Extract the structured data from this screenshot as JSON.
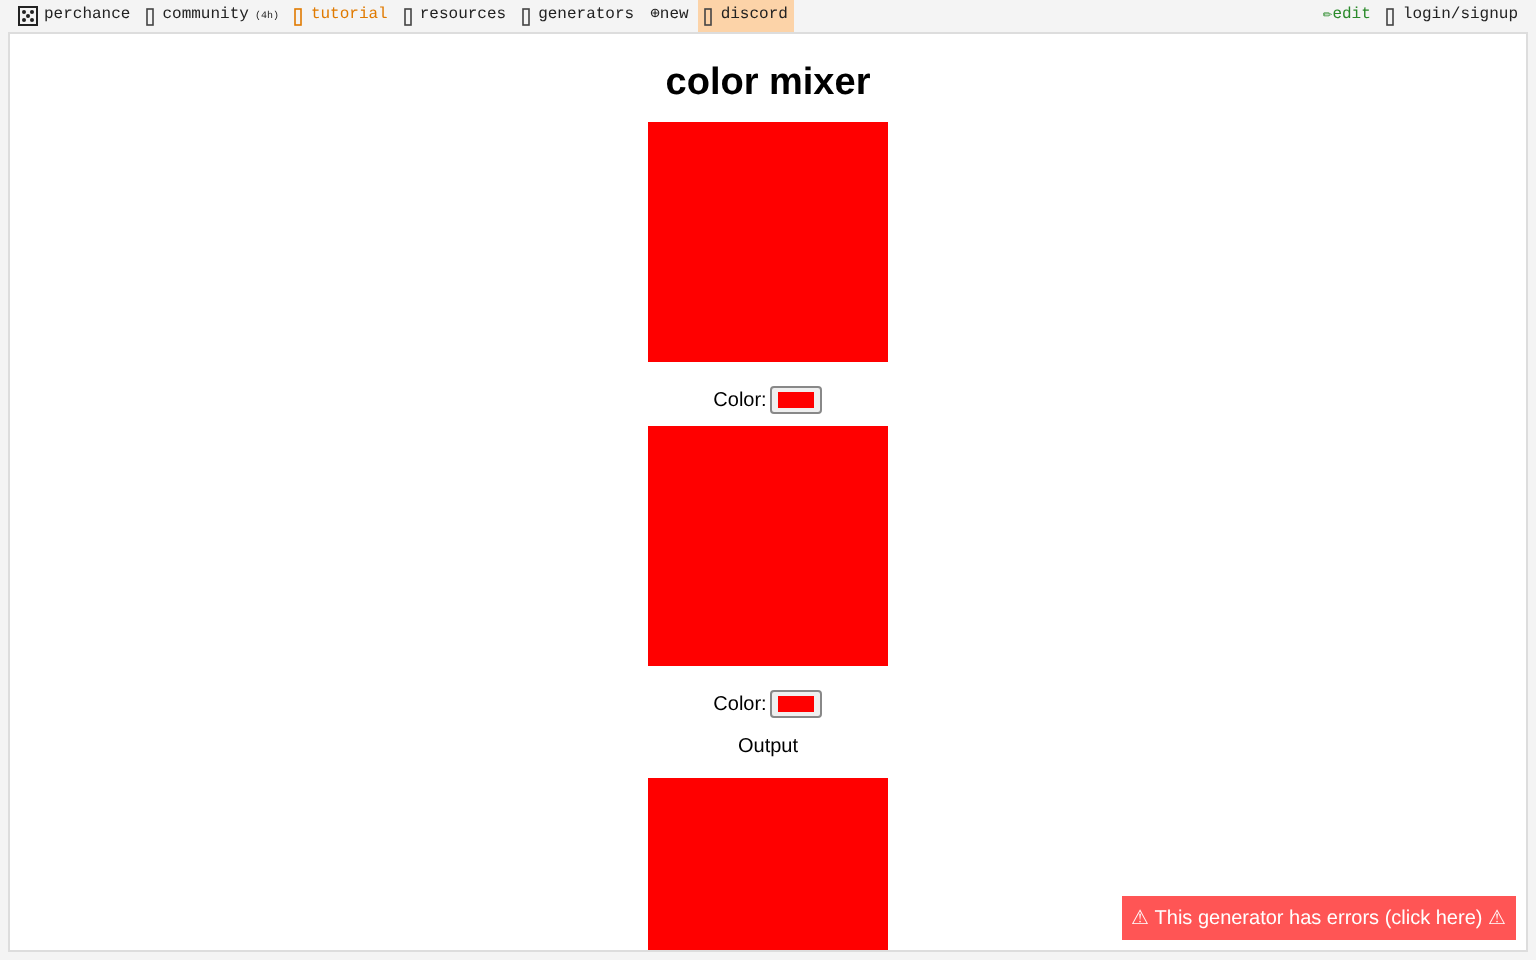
{
  "nav": {
    "left": [
      {
        "kind": "dice",
        "label": "perchance",
        "selected": false
      },
      {
        "kind": "box",
        "label": "community",
        "note": "(4h)",
        "selected": false
      },
      {
        "kind": "box",
        "label": "tutorial",
        "color": "#e07a00",
        "selected": false
      },
      {
        "kind": "box",
        "label": "resources",
        "selected": false
      },
      {
        "kind": "box",
        "label": "generators",
        "selected": false
      },
      {
        "kind": "glyph",
        "glyph": "⊕",
        "label": "new",
        "selected": false
      },
      {
        "kind": "box",
        "label": "discord",
        "selected": true
      }
    ],
    "right": [
      {
        "kind": "glyph",
        "glyph": "✏",
        "label": "edit",
        "color": "#2a8a2a",
        "selected": false
      },
      {
        "kind": "box",
        "label": "login/signup",
        "selected": false
      }
    ]
  },
  "title": "color mixer",
  "blocks": [
    {
      "kind": "swatch",
      "color": "#ff0000"
    },
    {
      "kind": "picker",
      "label": "Color:",
      "color": "#ff0000"
    },
    {
      "kind": "swatch",
      "color": "#ff0000"
    },
    {
      "kind": "picker",
      "label": "Color:",
      "color": "#ff0000"
    },
    {
      "kind": "text",
      "label": "Output"
    },
    {
      "kind": "swatch",
      "color": "#ff0000"
    }
  ],
  "error_banner": "⚠ This generator has errors (click here) ⚠"
}
